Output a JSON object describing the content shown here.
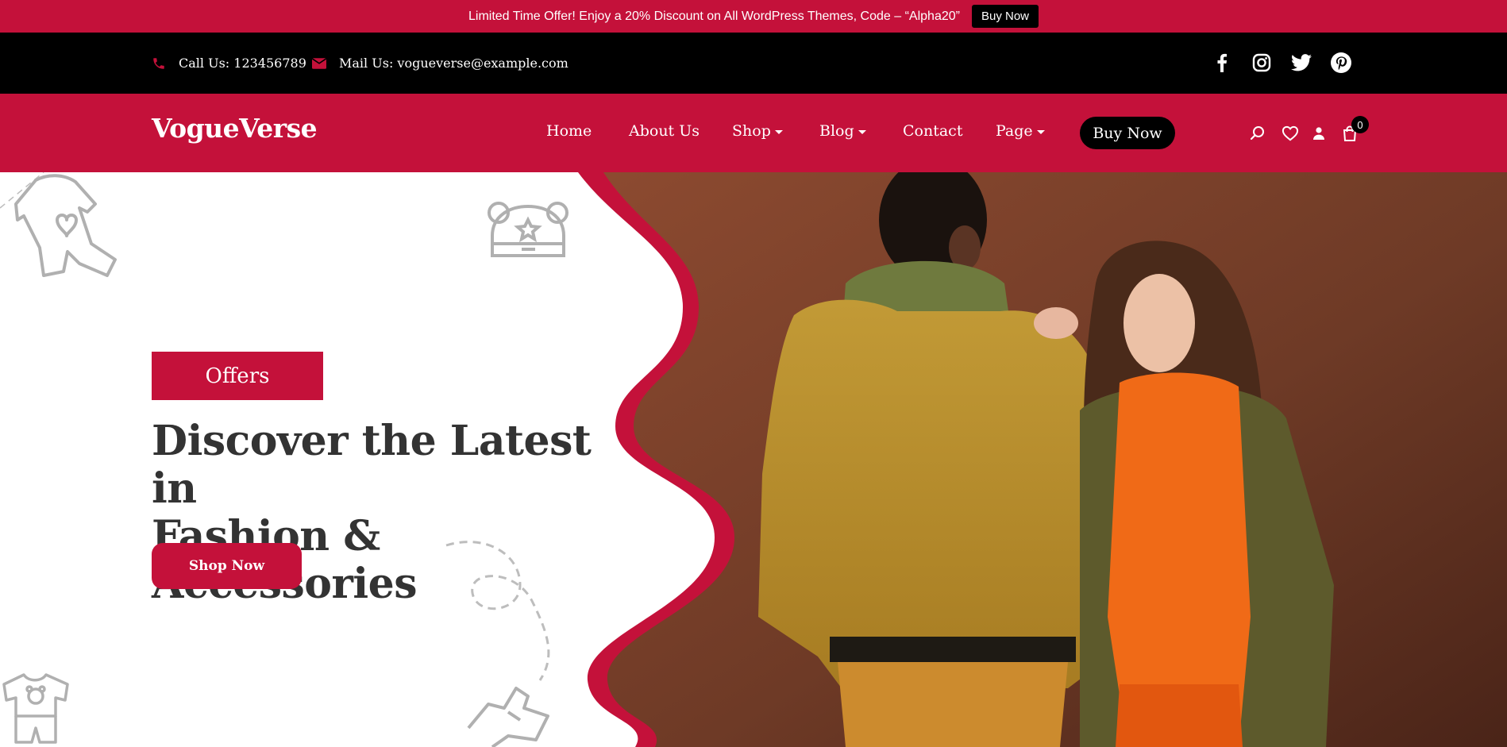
{
  "promo": {
    "text": "Limited Time Offer! Enjoy a 20% Discount on All WordPress Themes, Code – “Alpha20”",
    "button": "Buy Now"
  },
  "contact": {
    "phone": "Call Us: 123456789",
    "mail": "Mail Us: vogueverse@example.com",
    "phone_icon": "phone-icon",
    "mail_icon": "envelope-icon"
  },
  "social": [
    "facebook-icon",
    "instagram-icon",
    "twitter-icon",
    "pinterest-icon"
  ],
  "brand": {
    "logo": "VogueVerse"
  },
  "nav": {
    "items": [
      {
        "label": "Home"
      },
      {
        "label": "About Us"
      },
      {
        "label": "Shop"
      },
      {
        "label": "Blog"
      },
      {
        "label": "Contact"
      },
      {
        "label": "Page"
      }
    ],
    "buy_button": "Buy Now",
    "icons": [
      "search-icon",
      "heart-icon",
      "user-icon",
      "cart-icon"
    ],
    "cart_count": "0"
  },
  "hero": {
    "badge": "Offers",
    "headline_line1": "Discover the Latest in",
    "headline_line2": "Fashion & Accessories",
    "cta": "Shop Now"
  },
  "colors": {
    "accent": "#c4113a",
    "dark": "#000000",
    "heading": "#333333",
    "photo_bg": "#7a3f2a"
  }
}
